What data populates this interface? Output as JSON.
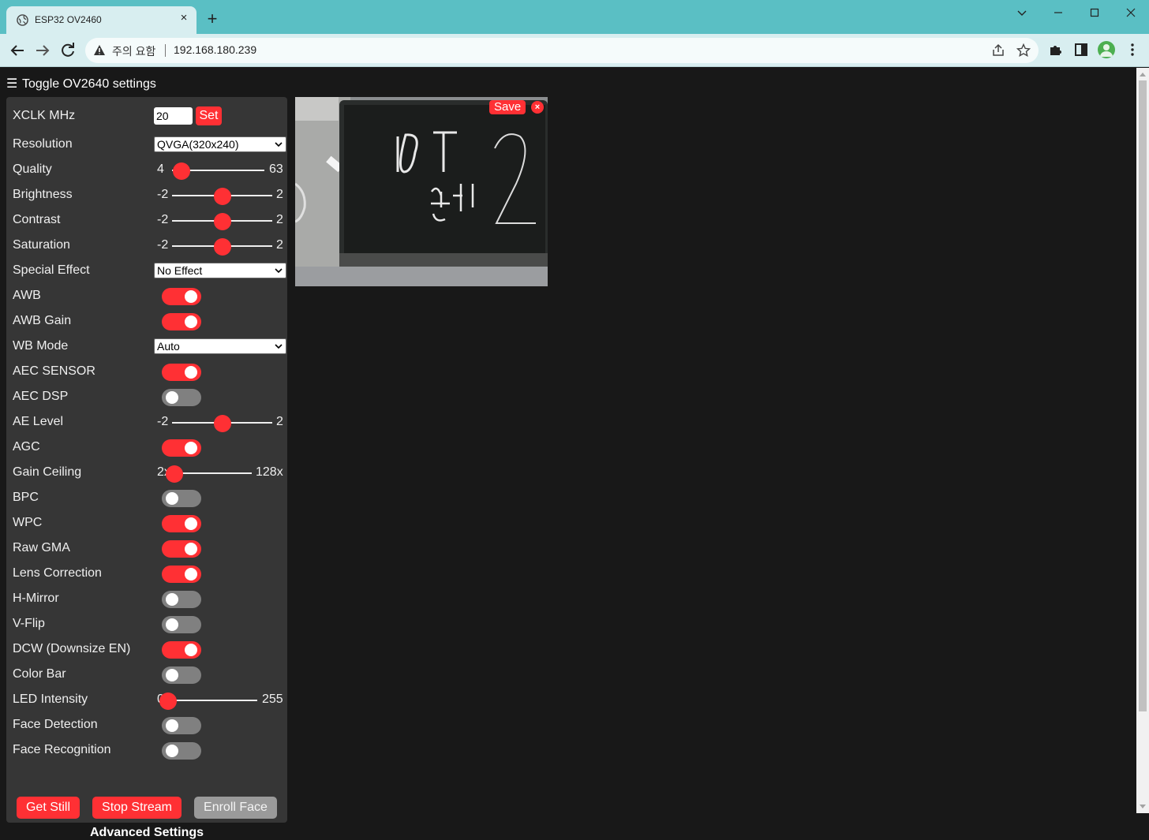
{
  "browser": {
    "tab_title": "ESP32 OV2460",
    "tab_close": "×",
    "new_tab": "+",
    "security_warning": "주의 요함",
    "url": "192.168.180.239"
  },
  "page": {
    "toggle_label": "Toggle OV2640 settings",
    "hamburger": "☰"
  },
  "settings": {
    "xclk": {
      "label": "XCLK MHz",
      "value": "20",
      "set_label": "Set"
    },
    "resolution": {
      "label": "Resolution",
      "selected": "QVGA(320x240)"
    },
    "quality": {
      "label": "Quality",
      "min": "4",
      "max": "63",
      "value": 10
    },
    "brightness": {
      "label": "Brightness",
      "min": "-2",
      "max": "2",
      "value": 0
    },
    "contrast": {
      "label": "Contrast",
      "min": "-2",
      "max": "2",
      "value": 0
    },
    "saturation": {
      "label": "Saturation",
      "min": "-2",
      "max": "2",
      "value": 0
    },
    "special_effect": {
      "label": "Special Effect",
      "selected": "No Effect"
    },
    "awb": {
      "label": "AWB",
      "on": true
    },
    "awb_gain": {
      "label": "AWB Gain",
      "on": true
    },
    "wb_mode": {
      "label": "WB Mode",
      "selected": "Auto"
    },
    "aec_sensor": {
      "label": "AEC SENSOR",
      "on": true
    },
    "aec_dsp": {
      "label": "AEC DSP",
      "on": false
    },
    "ae_level": {
      "label": "AE Level",
      "min": "-2",
      "max": "2",
      "value": 0
    },
    "agc": {
      "label": "AGC",
      "on": true
    },
    "gain_ceiling": {
      "label": "Gain Ceiling",
      "min": "2x",
      "max": "128x",
      "value": 0
    },
    "bpc": {
      "label": "BPC",
      "on": false
    },
    "wpc": {
      "label": "WPC",
      "on": true
    },
    "raw_gma": {
      "label": "Raw GMA",
      "on": true
    },
    "lens_correction": {
      "label": "Lens Correction",
      "on": true
    },
    "h_mirror": {
      "label": "H-Mirror",
      "on": false
    },
    "v_flip": {
      "label": "V-Flip",
      "on": false
    },
    "dcw": {
      "label": "DCW (Downsize EN)",
      "on": true
    },
    "color_bar": {
      "label": "Color Bar",
      "on": false
    },
    "led_intensity": {
      "label": "LED Intensity",
      "min": "0",
      "max": "255",
      "value": 0
    },
    "face_detection": {
      "label": "Face Detection",
      "on": false
    },
    "face_recognition": {
      "label": "Face Recognition",
      "on": false
    }
  },
  "actions": {
    "get_still": "Get Still",
    "stop_stream": "Stop Stream",
    "enroll_face": "Enroll Face",
    "advanced": "Advanced Settings"
  },
  "stream": {
    "save_label": "Save",
    "close_label": "×"
  },
  "colors": {
    "accent": "#ff3034",
    "panel": "#363636",
    "background": "#181818",
    "switch_off": "#808080"
  }
}
